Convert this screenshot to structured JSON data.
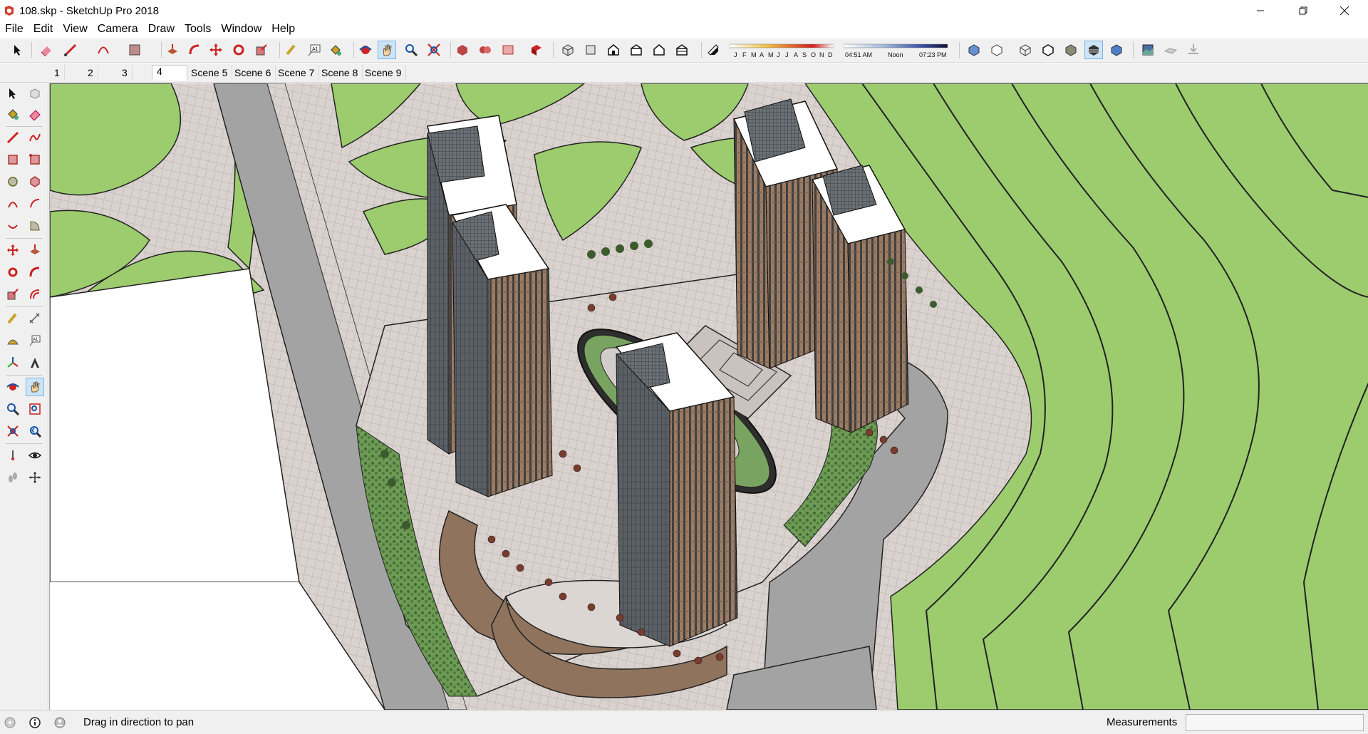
{
  "window": {
    "title": "108.skp - SketchUp Pro 2018",
    "minimize_icon": "minimize-icon",
    "restore_icon": "restore-icon",
    "close_icon": "close-icon"
  },
  "menu": [
    "File",
    "Edit",
    "View",
    "Camera",
    "Draw",
    "Tools",
    "Window",
    "Help"
  ],
  "shadow_settings": {
    "months": [
      "J",
      "F",
      "M",
      "A",
      "M",
      "J",
      "J",
      "A",
      "S",
      "O",
      "N",
      "D"
    ],
    "time_start": "04:51 AM",
    "time_mid": "Noon",
    "time_end": "07:23 PM"
  },
  "scenes": {
    "tabs": [
      "1",
      "2",
      "3",
      "4",
      "Scene 5",
      "Scene 6",
      "Scene 7",
      "Scene 8",
      "Scene 9"
    ],
    "active_index": 3
  },
  "toolbar_icons": [
    "select-arrow-icon",
    "eraser-icon",
    "pencil-line-icon",
    "arc-icon",
    "rectangle-icon",
    "push-pull-icon",
    "follow-me-icon",
    "move-icon",
    "rotate-icon",
    "scale-icon",
    "tape-measure-icon",
    "text-icon",
    "paint-bucket-icon",
    "orbit-icon",
    "pan-hand-icon",
    "zoom-icon",
    "zoom-extents-icon",
    "3d-warehouse-icon",
    "extension-warehouse-icon",
    "layout-send-icon",
    "extension-manager-icon",
    "iso-view-icon",
    "top-view-icon",
    "front-view-icon",
    "right-view-icon",
    "back-view-icon",
    "left-view-icon",
    "shadows-toggle-icon",
    "xray-icon",
    "back-edges-icon",
    "wireframe-icon",
    "hidden-line-icon",
    "shaded-icon",
    "shaded-textures-icon",
    "monochrome-icon",
    "match-photo-icon",
    "sandbox-icon"
  ],
  "left_tools": [
    "select-icon",
    "make-component-icon",
    "paint-bucket-icon",
    "eraser-icon",
    "line-icon",
    "freehand-icon",
    "rectangle-icon",
    "rotated-rectangle-icon",
    "circle-icon",
    "polygon-icon",
    "arc-icon",
    "two-point-arc-icon",
    "pie-icon",
    "three-point-arc-icon",
    "move-icon",
    "push-pull-icon",
    "rotate-icon",
    "follow-me-icon",
    "scale-icon",
    "offset-icon",
    "tape-measure-icon",
    "dimension-icon",
    "protractor-icon",
    "text-icon",
    "axes-icon",
    "3d-text-icon",
    "orbit-icon",
    "pan-icon",
    "zoom-icon",
    "zoom-window-icon",
    "zoom-extents-icon",
    "previous-view-icon",
    "position-camera-icon",
    "look-around-icon",
    "walk-icon",
    "section-plane-icon"
  ],
  "status": {
    "text": "Drag in direction to pan",
    "measurements_label": "Measurements",
    "measurements_value": ""
  },
  "colors": {
    "chrome": "#f0f0f0",
    "grass": "#9ccc6e",
    "road": "#a3a3a3",
    "paving": "#d6cfcb",
    "building_glass": "#5e6468",
    "building_wall": "#9b7b62",
    "roof": "#ffffff"
  }
}
